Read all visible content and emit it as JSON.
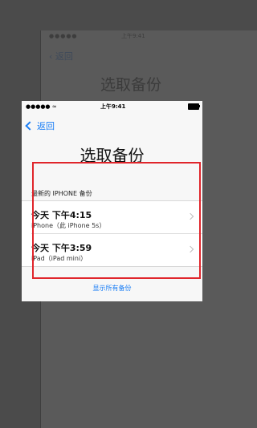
{
  "background": {
    "status_time": "上午9:41",
    "back_label": "返回",
    "title": "选取备份"
  },
  "status_bar": {
    "time": "上午9:41"
  },
  "nav": {
    "back_label": "返回"
  },
  "page": {
    "title": "选取备份",
    "section_header": "最新的 IPHONE 备份"
  },
  "backups": [
    {
      "title": "今天 下午4:15",
      "device": "iPhone（此 iPhone 5s）"
    },
    {
      "title": "今天 下午3:59",
      "device": "iPad（iPad mini）"
    }
  ],
  "show_all_label": "显示所有备份",
  "colors": {
    "accent": "#1a7ef5",
    "highlight": "#e0252b",
    "overlay": "#4b4b4b"
  }
}
